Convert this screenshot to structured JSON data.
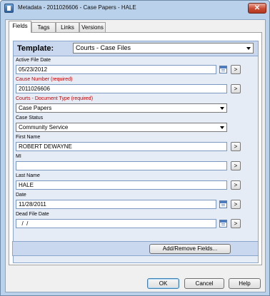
{
  "window": {
    "title": "Metadata - 2011026606 - Case Papers - HALE",
    "close_symbol": "✕"
  },
  "tabs": [
    {
      "label": "Fields",
      "active": true
    },
    {
      "label": "Tags",
      "active": false
    },
    {
      "label": "Links",
      "active": false
    },
    {
      "label": "Versions",
      "active": false
    }
  ],
  "template": {
    "label": "Template:",
    "value": "Courts - Case Files"
  },
  "fields": {
    "active_file_date": {
      "label": "Active File Date",
      "value": "05/23/2012"
    },
    "cause_number": {
      "label": "Cause Number (required)",
      "value": "2011026606"
    },
    "document_type": {
      "label": "Courts - Document Type (required)",
      "value": "Case Papers"
    },
    "case_status": {
      "label": "Case Status",
      "value": "Community Service"
    },
    "first_name": {
      "label": "First Name",
      "value": "ROBERT DEWAYNE"
    },
    "mi": {
      "label": "MI",
      "value": ""
    },
    "last_name": {
      "label": "Last Name",
      "value": "HALE"
    },
    "date": {
      "label": "Date",
      "value": "11/28/2011"
    },
    "dead_file_date": {
      "label": "Dead File Date",
      "value": "  /  /"
    }
  },
  "go_symbol": ">",
  "add_remove_label": "Add/Remove Fields...",
  "buttons": {
    "ok": "OK",
    "cancel": "Cancel",
    "help": "Help"
  },
  "colors": {
    "required_label": "#c00000",
    "panel_header": "#c9d8ee",
    "panel_body": "#e5ecf6",
    "window_frame": "#b9d1ea"
  }
}
